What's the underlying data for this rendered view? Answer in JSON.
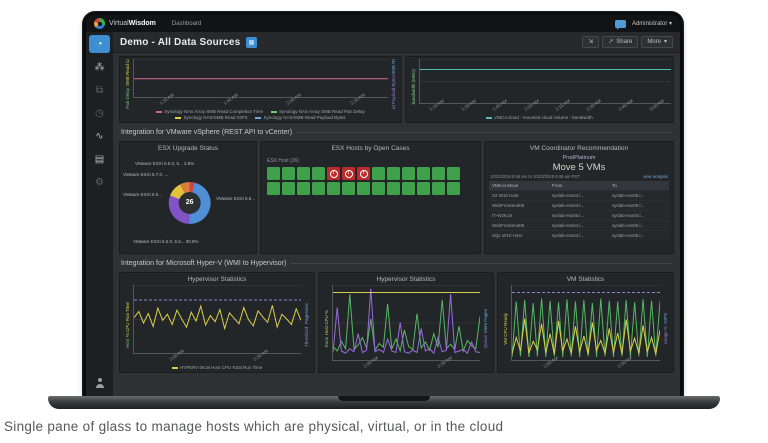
{
  "caption": "Single pane of glass to manage hosts which are physical, virtual, or in the cloud",
  "topbar": {
    "brand_a": "Virtual",
    "brand_b": "Wisdom",
    "nav": [
      {
        "label": "Dashboard",
        "active": true
      }
    ],
    "user": "Administrator",
    "user_caret": "▾"
  },
  "titlebar": {
    "title": "Demo - All Data Sources",
    "expand_glyph": "⇲",
    "share_glyph": "↗",
    "share_label": "Share",
    "more_label": "More",
    "more_caret": "▾"
  },
  "sidebar": {
    "items": [
      {
        "name": "dashboards",
        "glyph": "◔",
        "active": true
      },
      {
        "name": "topology",
        "glyph": "⁂"
      },
      {
        "name": "entities",
        "glyph": "⧉",
        "dim": true
      },
      {
        "name": "schedule",
        "glyph": "◷",
        "dim": true
      },
      {
        "name": "analytics",
        "glyph": "∿"
      },
      {
        "name": "reports",
        "glyph": "▤"
      },
      {
        "name": "settings",
        "glyph": "⚙",
        "dim": true
      }
    ]
  },
  "sections": {
    "vsphere": "Integration for VMware vSphere (REST API to vCenter)",
    "hyperv": "Integration for Microsoft Hyper-V (WMI to Hypervisor)"
  },
  "esx_hosts": {
    "title": "ESX Hosts by Open Cases",
    "group_label": "ESX Host (26)",
    "alert_glyph": "!",
    "cells": [
      "ok",
      "ok",
      "ok",
      "ok",
      "alert",
      "alert",
      "alert",
      "ok",
      "ok",
      "ok",
      "ok",
      "ok",
      "ok",
      "ok",
      "ok",
      "ok",
      "ok",
      "ok",
      "ok",
      "ok",
      "ok",
      "ok",
      "ok",
      "ok",
      "ok",
      "ok"
    ]
  },
  "vm_recommendation": {
    "title": "VM Coordinator Recommendation",
    "tier": "ProdPlatinum",
    "headline": "Move 5 VMs",
    "period": "10/22/2018 8:46 am to 10/23/2018 8:46 am PST",
    "link": "view analysis",
    "headers": [
      "VMs to Move",
      "From",
      "To"
    ],
    "rows": [
      [
        "S2 W10 Host",
        "syslab-esx04.l...",
        "syslab-esx05.l..."
      ],
      [
        "WebFrontend09",
        "syslab-esx04.l...",
        "syslab-esx05.l..."
      ],
      [
        "IT-W2K19",
        "syslab-esx05.l...",
        "syslab-esx04.l..."
      ],
      [
        "WebFrontend08",
        "syslab-esx04.l...",
        "syslab-esx05.l..."
      ],
      [
        "SQL W10 Host",
        "syslab-esx04.l...",
        "syslab-esx05.l..."
      ]
    ]
  },
  "chart_data": [
    {
      "id": "nas-array",
      "type": "line",
      "title": "",
      "x": [
        "1:20 AM",
        "1:40 AM",
        "2:00 AM",
        "2:20 AM"
      ],
      "ylim": [
        0,
        100
      ],
      "axis_left": [
        {
          "text": "SMB Read Completion Time",
          "color": "#d9cf4a"
        },
        {
          "text": "SMB Read Pair Delay",
          "color": "#7cc77c"
        }
      ],
      "axis_right": [
        {
          "text": "SMB Read IOPS",
          "color": "#6fa8dc"
        },
        {
          "text": "SMB Read Payload Bytes",
          "color": "#9a7fd1"
        }
      ],
      "series": [
        {
          "name": "Synology NAS Array SMB Read Completion Time",
          "color": "#d4688e",
          "values": [
            48,
            48,
            48,
            48,
            48,
            48,
            48,
            48,
            48,
            48,
            48,
            48,
            48
          ]
        }
      ],
      "legend": [
        {
          "label": "Synology NAS Array SMB Read Completion Time",
          "color": "#d4688e"
        },
        {
          "label": "Synology NAS Array SMB Read Pair Delay",
          "color": "#7cc77c"
        },
        {
          "label": "Synology NAS/SMB Read IOPS",
          "color": "#d9cf4a"
        },
        {
          "label": "Synology NAS/SMB Read Payload Bytes",
          "color": "#6fa8dc"
        }
      ]
    },
    {
      "id": "cloud-volume",
      "type": "line",
      "title": "",
      "x": [
        "1:15 AM",
        "1:30 AM",
        "1:45 AM",
        "2:00 AM",
        "2:15 AM",
        "2:30 AM",
        "2:45 AM",
        "3:00 AM"
      ],
      "ylim": [
        0,
        100
      ],
      "axis_left": [
        {
          "text": "Bandwidth (MB/s)",
          "color": "#7cc77c"
        }
      ],
      "axis_right": [],
      "series": [
        {
          "name": "vNIC4.cloud - mounted cloud volume - bandwidth",
          "color": "#52bdb0",
          "values": [
            76,
            76,
            76,
            76,
            76,
            76,
            76,
            76,
            76,
            76,
            76,
            76,
            76
          ]
        }
      ],
      "legend": [
        {
          "label": "vNIC4.cloud - mounted cloud volume - bandwidth",
          "color": "#52bdb0"
        }
      ]
    },
    {
      "id": "esx-upgrade",
      "type": "donut",
      "title": "ESX Upgrade Status",
      "total": "26",
      "slices": [
        {
          "label": "VMware ESXi 5.5.0, 5... 3.8%",
          "value": 3.8,
          "color": "#cc4444"
        },
        {
          "label": "VMware ESXi 6.5...",
          "value": 46.2,
          "color": "#4f8fd6"
        },
        {
          "label": "VMware ESXi 5.5.0, 5.5... 30.8%",
          "value": 30.8,
          "color": "#8153c7"
        },
        {
          "label": "VMware ESXi 6.0...",
          "value": 11.5,
          "color": "#e3c23c"
        },
        {
          "label": "VMware ESXi 5.7.0, ...",
          "value": 7.7,
          "color": "#d8803a"
        }
      ]
    },
    {
      "id": "hyperv-1",
      "type": "line",
      "title": "Hypervisor Statistics",
      "x": [
        "2:00 AM",
        "2:30 AM"
      ],
      "ylim": [
        0,
        100
      ],
      "axis_left": [
        {
          "text": "% CPU Run Time",
          "color": "#d9cf4a"
        },
        {
          "text": "Host",
          "color": "#7cc77c"
        }
      ],
      "axis_right": [
        {
          "text": "Pages/sec",
          "color": "#6fa8dc"
        },
        {
          "text": "Threshold",
          "color": "#9a7fd1"
        }
      ],
      "series": [
        {
          "name": "HYPERV-2K19 Host CPU Total Run Time",
          "color": "#d9cf4a",
          "values": [
            52,
            61,
            44,
            58,
            39,
            66,
            48,
            57,
            42,
            63,
            50,
            38,
            60,
            47,
            69,
            41,
            55,
            46,
            64,
            36,
            59,
            51,
            43,
            67,
            49,
            40,
            62,
            53,
            45,
            70,
            38,
            57,
            50,
            42,
            65,
            48
          ]
        },
        {
          "name": "threshold",
          "color": "#9a7fd1",
          "dash": true,
          "values": [
            78,
            78
          ]
        }
      ],
      "legend": [
        {
          "label": "HYPERV-2K19 Host CPU Total Run Time",
          "color": "#d9cf4a"
        }
      ]
    },
    {
      "id": "hyperv-2",
      "type": "line",
      "title": "Hypervisor Statistics",
      "x": [
        "2:00 AM",
        "2:30 AM"
      ],
      "ylim": [
        0,
        100
      ],
      "axis_left": [
        {
          "text": "Host CPU %",
          "color": "#d9cf4a"
        },
        {
          "text": "Runs",
          "color": "#7cc77c"
        }
      ],
      "axis_right": [
        {
          "text": "Mem Pages",
          "color": "#6fa8dc"
        },
        {
          "text": "Queue",
          "color": "#9a7fd1"
        }
      ],
      "series": [
        {
          "name": "host-cpu",
          "color": "#56b864",
          "values": [
            18,
            12,
            25,
            15,
            88,
            14,
            20,
            30,
            16,
            55,
            13,
            22,
            17,
            75,
            15,
            28,
            12,
            40,
            18,
            14,
            62,
            16,
            24,
            13,
            35,
            17,
            80,
            15,
            21,
            14,
            45,
            12,
            26,
            19,
            15,
            58
          ]
        },
        {
          "name": "mem-pages",
          "color": "#9a6ae0",
          "values": [
            10,
            70,
            12,
            9,
            15,
            11,
            35,
            10,
            13,
            95,
            11,
            14,
            10,
            28,
            12,
            10,
            50,
            11,
            9,
            13,
            10,
            42,
            12,
            15,
            9,
            30,
            11,
            13,
            88,
            10,
            12,
            14,
            9,
            24,
            11,
            10
          ]
        },
        {
          "name": "threshold",
          "color": "#d9cf4a",
          "values": [
            90,
            90
          ]
        }
      ],
      "legend": []
    },
    {
      "id": "vm-stats",
      "type": "line",
      "title": "VM Statistics",
      "x": [
        "2:00 AM",
        "2:30 AM"
      ],
      "ylim": [
        0,
        100
      ],
      "axis_left": [
        {
          "text": "VM CPU Ready",
          "color": "#d9cf4a"
        }
      ],
      "axis_right": [
        {
          "text": "IOPS",
          "color": "#6fa8dc"
        },
        {
          "text": "Usage %",
          "color": "#9a7fd1"
        }
      ],
      "series": [
        {
          "name": "vm-cpu",
          "color": "#56b864",
          "values": [
            4,
            78,
            5,
            80,
            4,
            76,
            5,
            82,
            4,
            79,
            5,
            77,
            4,
            81,
            5,
            78,
            4,
            80,
            5,
            76,
            4,
            82,
            5,
            79,
            4,
            78,
            5,
            80,
            4,
            77,
            5,
            81,
            4,
            79,
            5,
            78
          ]
        },
        {
          "name": "vm-iops",
          "color": "#d9cf4a",
          "values": [
            8,
            30,
            12,
            55,
            9,
            25,
            14,
            48,
            10,
            35,
            8,
            52,
            12,
            28,
            9,
            45,
            11,
            32,
            8,
            50,
            13,
            26,
            9,
            42,
            10,
            36,
            8,
            54,
            12,
            29,
            9,
            46,
            11,
            30,
            8,
            40
          ]
        },
        {
          "name": "threshold",
          "color": "#9a7fd1",
          "dash": true,
          "values": [
            90,
            90
          ]
        }
      ],
      "legend": []
    }
  ]
}
